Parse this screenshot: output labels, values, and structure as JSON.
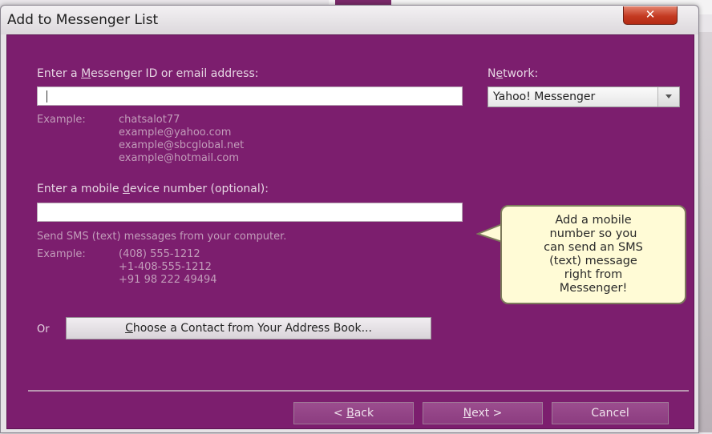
{
  "window": {
    "title": "Add to Messenger List",
    "close_label": "✕"
  },
  "id_section": {
    "label_pre": "Enter a ",
    "label_u": "M",
    "label_post": "essenger ID or email address:",
    "value": "",
    "example_label": "Example:",
    "examples": [
      "chatsalot77",
      "example@yahoo.com",
      "example@sbcglobal.net",
      "example@hotmail.com"
    ]
  },
  "network": {
    "label_pre": "N",
    "label_u": "e",
    "label_post": "twork:",
    "selected": "Yahoo! Messenger"
  },
  "mobile_section": {
    "label_pre": "Enter a mobile ",
    "label_u": "d",
    "label_post": "evice number (optional):",
    "value": "",
    "hint": "Send SMS (text) messages from your computer.",
    "example_label": "Example:",
    "examples": [
      "(408) 555-1212",
      "+1-408-555-1212",
      "+91 98 222 49494"
    ]
  },
  "callout": {
    "text": "Add a mobile\nnumber so you\ncan send an SMS\n(text) message\nright from\nMessenger!"
  },
  "address_book": {
    "or_label": "Or",
    "button_u": "C",
    "button_rest": "hoose a Contact from Your Address Book..."
  },
  "footer": {
    "back_pre": "< ",
    "back_u": "B",
    "back_post": "ack",
    "next_u": "N",
    "next_post": "ext >",
    "cancel": "Cancel"
  }
}
